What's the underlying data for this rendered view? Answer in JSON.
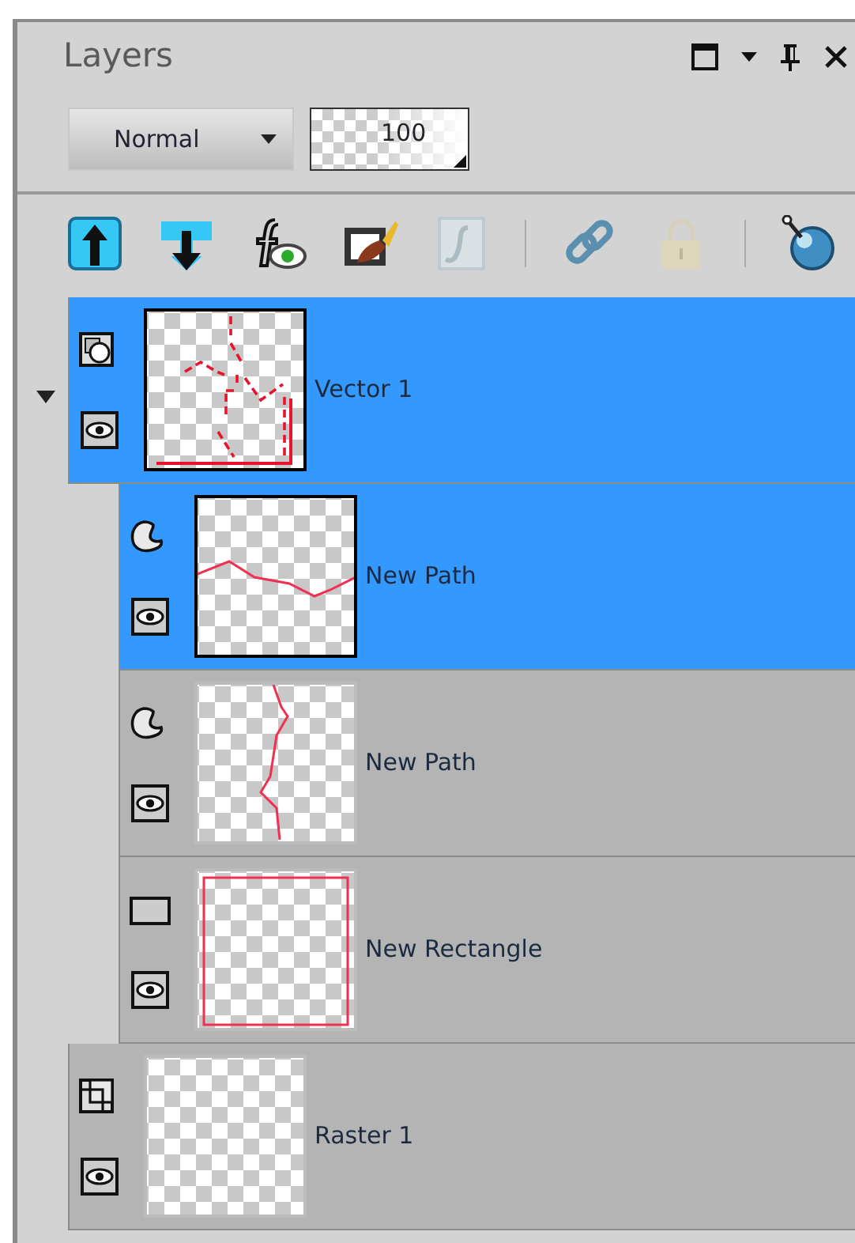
{
  "panel": {
    "title": "Layers"
  },
  "blend_mode": {
    "value": "Normal"
  },
  "opacity": {
    "value": "100"
  },
  "toolbar": [
    {
      "kind": "move-up",
      "disabled": false
    },
    {
      "kind": "move-down",
      "disabled": false
    },
    {
      "kind": "effects-visibility",
      "disabled": false
    },
    {
      "kind": "edit-brush",
      "disabled": false
    },
    {
      "kind": "script",
      "disabled": true
    },
    {
      "kind": "separator"
    },
    {
      "kind": "link",
      "disabled": false
    },
    {
      "kind": "lock",
      "disabled": true
    },
    {
      "kind": "separator"
    },
    {
      "kind": "knob",
      "disabled": false
    }
  ],
  "layers": [
    {
      "name": "Vector 1",
      "kind": "vector",
      "selected": true,
      "visible": true,
      "expanded": true,
      "children": [
        {
          "name": "New Path",
          "kind": "path",
          "selected": true,
          "visible": true
        },
        {
          "name": "New Path",
          "kind": "path",
          "selected": false,
          "visible": true
        },
        {
          "name": "New Rectangle",
          "kind": "rectangle",
          "selected": false,
          "visible": true
        }
      ]
    },
    {
      "name": "Raster 1",
      "kind": "raster",
      "selected": false,
      "visible": true
    }
  ]
}
